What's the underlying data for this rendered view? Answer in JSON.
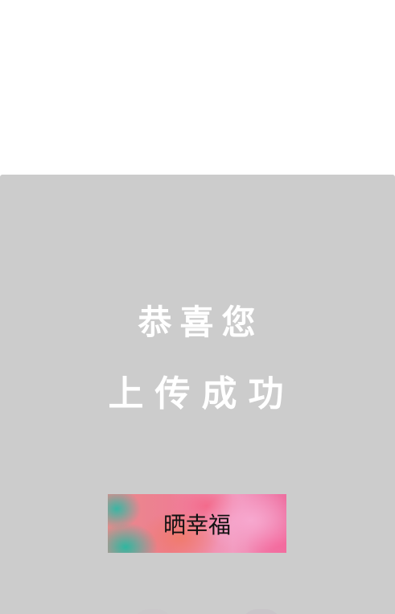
{
  "dialog": {
    "message_line1": "恭喜您",
    "message_line2": "上传成功",
    "share_button_label": "晒幸福"
  },
  "colors": {
    "overlay": "#cccccc",
    "message_text": "#ffffff",
    "button_text": "#111111"
  }
}
